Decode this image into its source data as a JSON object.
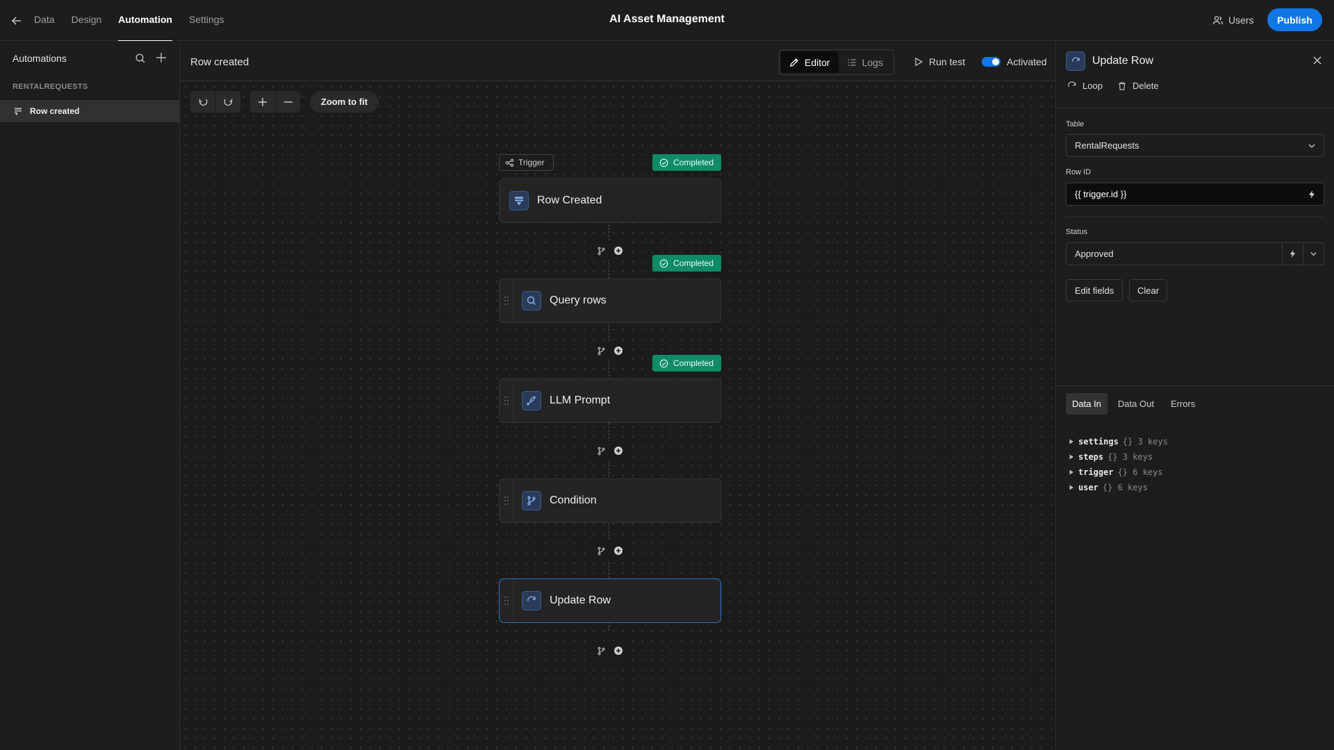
{
  "topbar": {
    "nav": [
      "Data",
      "Design",
      "Automation",
      "Settings"
    ],
    "active_nav": "Automation",
    "app_title": "AI Asset Management",
    "users_label": "Users",
    "publish_label": "Publish"
  },
  "sidebar": {
    "title": "Automations",
    "section": "RENTALREQUESTS",
    "items": [
      {
        "label": "Row created",
        "active": true
      }
    ]
  },
  "canvas_header": {
    "title": "Row created",
    "tabs": [
      {
        "label": "Editor",
        "active": true
      },
      {
        "label": "Logs",
        "active": false
      }
    ],
    "run_test_label": "Run test",
    "activated_label": "Activated"
  },
  "canvas": {
    "zoom_fit_label": "Zoom to fit",
    "trigger_tag": "Trigger",
    "status_label": "Completed",
    "nodes": [
      {
        "label": "Row Created",
        "icon": "table-icon",
        "status": "Completed"
      },
      {
        "label": "Query rows",
        "icon": "search-icon",
        "status": "Completed"
      },
      {
        "label": "LLM Prompt",
        "icon": "prompt-icon",
        "status": "Completed"
      },
      {
        "label": "Condition",
        "icon": "branch-icon",
        "status": ""
      },
      {
        "label": "Update Row",
        "icon": "refresh-icon",
        "status": "",
        "selected": true
      }
    ]
  },
  "panel": {
    "title": "Update Row",
    "loop_label": "Loop",
    "delete_label": "Delete",
    "table_label": "Table",
    "table_value": "RentalRequests",
    "row_id_label": "Row ID",
    "row_id_value": "{{ trigger.id }}",
    "status_label": "Status",
    "status_value": "Approved",
    "edit_fields_label": "Edit fields",
    "clear_label": "Clear",
    "data_tabs": [
      {
        "label": "Data In",
        "active": true
      },
      {
        "label": "Data Out",
        "active": false
      },
      {
        "label": "Errors",
        "active": false
      }
    ],
    "tree": [
      {
        "key": "settings",
        "meta": "{} 3 keys"
      },
      {
        "key": "steps",
        "meta": "{} 3 keys"
      },
      {
        "key": "trigger",
        "meta": "{} 6 keys"
      },
      {
        "key": "user",
        "meta": "{} 6 keys"
      }
    ]
  },
  "colors": {
    "accent": "#1177e6",
    "completed": "#0f8b65",
    "node_icon_bg": "#2a3b5a"
  }
}
